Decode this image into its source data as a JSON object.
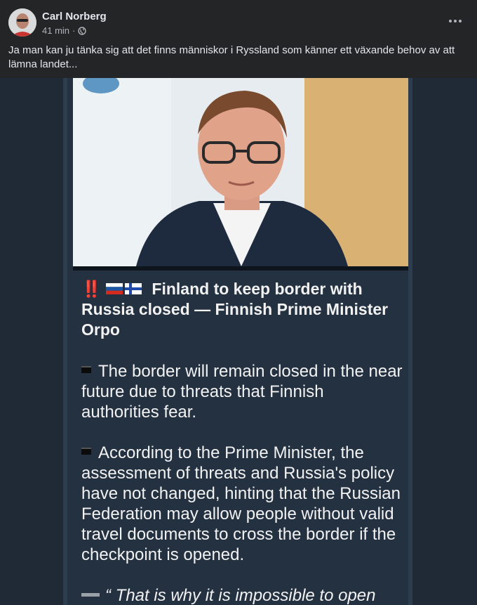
{
  "post": {
    "author": "Carl Norberg",
    "time": "41 min",
    "separator": "·",
    "caption": "Ja man kan ju tänka sig att det finns människor i Ryssland som känner ett växande behov av att lämna landet..."
  },
  "card": {
    "headline_marker": "‼️",
    "headline": "Finland to keep border with Russia closed — Finnish Prime Minister Orpo",
    "paragraphs": [
      "The border will remain closed in the near future due to threats that Finnish authorities fear.",
      "According to the Prime Minister, the assessment of threats and Russia's policy have not changed, hinting that the Russian Federation may allow people without valid travel documents to cross the border if the checkpoint is opened.",
      "“ That is why it is impossible to open"
    ]
  },
  "colors": {
    "background": "#242526",
    "card": "#243140",
    "text": "#e4e6eb",
    "muted": "#b0b3b8"
  },
  "icons": {
    "privacy": "globe-icon",
    "menu": "more-options-icon",
    "flags": [
      "russia-flag-icon",
      "finland-flag-icon"
    ]
  }
}
